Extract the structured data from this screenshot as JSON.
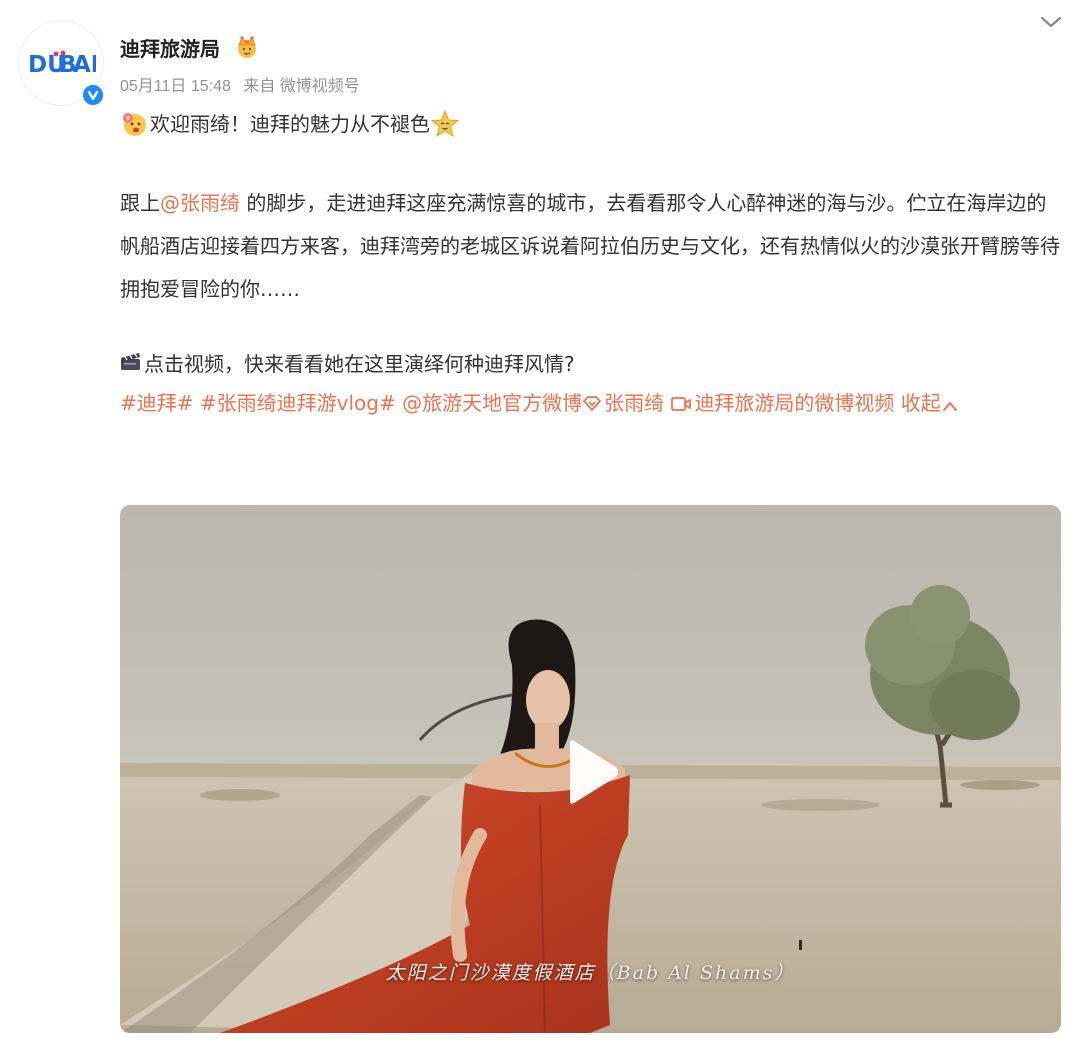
{
  "post": {
    "author": {
      "name": "迪拜旅游局",
      "avatar_text": "DUBAI",
      "verified": true,
      "badge_icon": "crown-icon"
    },
    "meta": {
      "time": "05月11日 15:48",
      "source": "来自 微博视频号"
    },
    "headline": {
      "text": "欢迎雨绮！迪拜的魅力从不褪色",
      "lead_emoji": "flower-face-icon",
      "trail_emoji": "star-face-icon"
    },
    "body": {
      "prefix": "跟上",
      "mention": "@张雨绮",
      "rest": " 的脚步，走进迪拜这座充满惊喜的城市，去看看那令人心醉神迷的海与沙。伫立在海岸边的帆船酒店迎接着四方来客，迪拜湾旁的老城区诉说着阿拉伯历史与文化，还有热情似火的沙漠张开臂膀等待拥抱爱冒险的你……"
    },
    "cta": {
      "icon": "clapperboard-icon",
      "text": "点击视频，快来看看她在这里演绎何种迪拜风情?"
    },
    "tags": {
      "tag1": "#迪拜#",
      "tag2": "#张雨绮迪拜游vlog#",
      "mention1": "@旅游天地官方微博",
      "with_person": "张雨绮",
      "video_link": "迪拜旅游局的微博视频",
      "collapse": "收起"
    },
    "video": {
      "caption": "太阳之门沙漠度假酒店（Bab Al Shams）"
    }
  },
  "colors": {
    "link": "#eb7350",
    "meta": "#939393",
    "verified": "#1d8bff"
  }
}
